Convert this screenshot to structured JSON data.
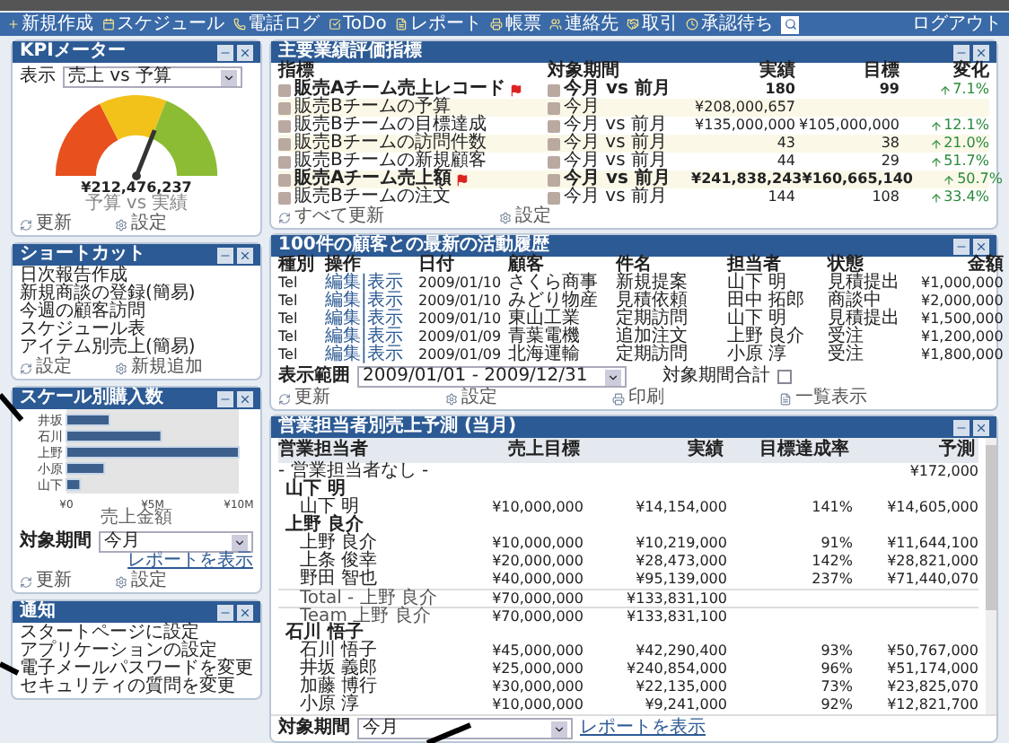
{
  "menu": {
    "items": [
      "新規作成",
      "スケジュール",
      "電話ログ",
      "ToDo",
      "レポート",
      "帳票",
      "連絡先",
      "取引",
      "承認待ち"
    ],
    "logout": "ログアウト"
  },
  "kpi_meter": {
    "title": "KPIメーター",
    "select": "売上 vs 予算",
    "select_label": "表示",
    "value": "¥212,476,237",
    "sub": "予算 vs 実績",
    "links": [
      "更新",
      "設定"
    ]
  },
  "shortcuts": {
    "title": "ショートカット",
    "items": [
      "日次報告作成",
      "新規商談の登録(簡易)",
      "今週の顧客訪問",
      "スケジュール表",
      "アイテム別売上(簡易)"
    ],
    "links": [
      "設定",
      "新規追加"
    ]
  },
  "sales_chart": {
    "title": "スケール別購入数",
    "chart_data": {
      "type": "bar",
      "orientation": "horizontal",
      "categories": [
        "井坂",
        "石川",
        "上野",
        "小原",
        "山下"
      ],
      "values": [
        2500000,
        5500000,
        10000000,
        2200000,
        800000
      ],
      "xlim": [
        0,
        10000000
      ],
      "xticks": [
        {
          "value": 0,
          "label": "¥0"
        },
        {
          "value": 5000000,
          "label": "¥5M"
        },
        {
          "value": 10000000,
          "label": "¥10M"
        }
      ],
      "xlabel": "売上金額"
    },
    "period_label": "対象期間",
    "period": "今月",
    "report_link": "レポートを表示",
    "links": [
      "更新",
      "設定"
    ]
  },
  "notices": {
    "title": "通知",
    "items": [
      "スタートページに設定",
      "アプリケーションの設定",
      "電子メールパスワードを変更",
      "セキュリティの質問を変更"
    ]
  },
  "kpi_table": {
    "title": "主要業績評価指標",
    "columns": [
      "指標",
      "対象期間",
      "実績",
      "目標",
      "変化"
    ],
    "rows": [
      {
        "name": "販売Aチーム売上レコード",
        "bold": true,
        "flag": true,
        "period": "今月 vs 前月",
        "actual": "180",
        "target": "99",
        "change": "7.1%"
      },
      {
        "name": "販売Bチームの予算",
        "bold": false,
        "flag": false,
        "period": "今月",
        "actual": "¥208,000,657",
        "target": "",
        "change": ""
      },
      {
        "name": "販売Bチームの目標達成",
        "bold": false,
        "flag": false,
        "period": "今月 vs 前月",
        "actual": "¥135,000,000",
        "target": "¥105,000,000",
        "change": "12.1%"
      },
      {
        "name": "販売Bチームの訪問件数",
        "bold": false,
        "flag": false,
        "period": "今月 vs 前月",
        "actual": "43",
        "target": "38",
        "change": "21.0%"
      },
      {
        "name": "販売Bチームの新規顧客",
        "bold": false,
        "flag": false,
        "period": "今月 vs 前月",
        "actual": "44",
        "target": "29",
        "change": "51.7%"
      },
      {
        "name": "販売Aチーム売上額",
        "bold": true,
        "flag": true,
        "period": "今月 vs 前月",
        "actual": "¥241,838,243",
        "target": "¥160,665,140",
        "change": "50.7%"
      },
      {
        "name": "販売Bチームの注文",
        "bold": false,
        "flag": false,
        "period": "今月 vs 前月",
        "actual": "144",
        "target": "108",
        "change": "33.4%"
      }
    ],
    "links": [
      "すべて更新",
      "設定"
    ]
  },
  "activity": {
    "title": "100件の顧客との最新の活動履歴",
    "columns": [
      "種別",
      "操作",
      "日付",
      "顧客",
      "件名",
      "担当者",
      "状態",
      "金額"
    ],
    "rows": [
      [
        "Tel",
        "編集|表示",
        "2009/01/10",
        "さくら商事",
        "新規提案",
        "山下 明",
        "見積提出",
        "¥1,000,000"
      ],
      [
        "Tel",
        "編集|表示",
        "2009/01/10",
        "みどり物産",
        "見積依頼",
        "田中 拓郎",
        "商談中",
        "¥2,000,000"
      ],
      [
        "Tel",
        "編集|表示",
        "2009/01/10",
        "東山工業",
        "定期訪問",
        "山下 明",
        "見積提出",
        "¥1,500,000"
      ],
      [
        "Tel",
        "編集|表示",
        "2009/01/09",
        "青葉電機",
        "追加注文",
        "上野 良介",
        "受注",
        "¥1,200,000"
      ],
      [
        "Tel",
        "編集|表示",
        "2009/01/09",
        "北海運輸",
        "定期訪問",
        "小原 淳",
        "受注",
        "¥1,800,000"
      ]
    ],
    "range_label": "表示範囲",
    "range": "2009/01/01 - 2009/12/31",
    "total_label": "対象期間合計",
    "total_checked": false,
    "links": [
      "更新",
      "設定",
      "印刷",
      "一覧表示"
    ]
  },
  "forecast": {
    "title": "営業担当者別売上予測 (当月)",
    "columns": [
      "営業担当者",
      "売上目標",
      "実績",
      "目標達成率",
      "予測"
    ],
    "rows": [
      {
        "kind": "note",
        "cells": [
          "- 営業担当者なし -",
          "",
          "",
          "",
          "¥172,000"
        ]
      },
      {
        "kind": "group",
        "cells": [
          "山下 明"
        ]
      },
      {
        "kind": "person",
        "cells": [
          "山下 明",
          "¥10,000,000",
          "¥14,154,000",
          "141%",
          "¥14,605,000"
        ]
      },
      {
        "kind": "group",
        "cells": [
          "上野 良介"
        ]
      },
      {
        "kind": "person",
        "cells": [
          "上野 良介",
          "¥10,000,000",
          "¥10,219,000",
          "91%",
          "¥11,644,100"
        ]
      },
      {
        "kind": "person",
        "cells": [
          "上条 俊幸",
          "¥20,000,000",
          "¥28,473,000",
          "142%",
          "¥28,821,000"
        ]
      },
      {
        "kind": "person",
        "cells": [
          "野田 智也",
          "¥40,000,000",
          "¥95,139,000",
          "237%",
          "¥71,440,070"
        ]
      },
      {
        "kind": "total",
        "cells": [
          "Total - 上野 良介",
          "¥70,000,000",
          "¥133,831,100"
        ]
      },
      {
        "kind": "total",
        "cells": [
          "Team 上野 良介",
          "¥70,000,000",
          "¥133,831,100"
        ]
      },
      {
        "kind": "group",
        "cells": [
          "石川 悟子"
        ]
      },
      {
        "kind": "person",
        "cells": [
          "石川 悟子",
          "¥45,000,000",
          "¥42,290,400",
          "93%",
          "¥50,767,000"
        ]
      },
      {
        "kind": "person",
        "cells": [
          "井坂 義郎",
          "¥25,000,000",
          "¥240,854,000",
          "96%",
          "¥51,174,000"
        ]
      },
      {
        "kind": "person",
        "cells": [
          "加藤 博行",
          "¥30,000,000",
          "¥22,135,000",
          "73%",
          "¥23,825,070"
        ]
      },
      {
        "kind": "person",
        "cells": [
          "小原 淳",
          "¥10,000,000",
          "¥9,241,000",
          "92%",
          "¥12,821,700"
        ]
      }
    ],
    "period_label": "対象期間",
    "period": "今月",
    "report_link": "レポートを表示"
  }
}
